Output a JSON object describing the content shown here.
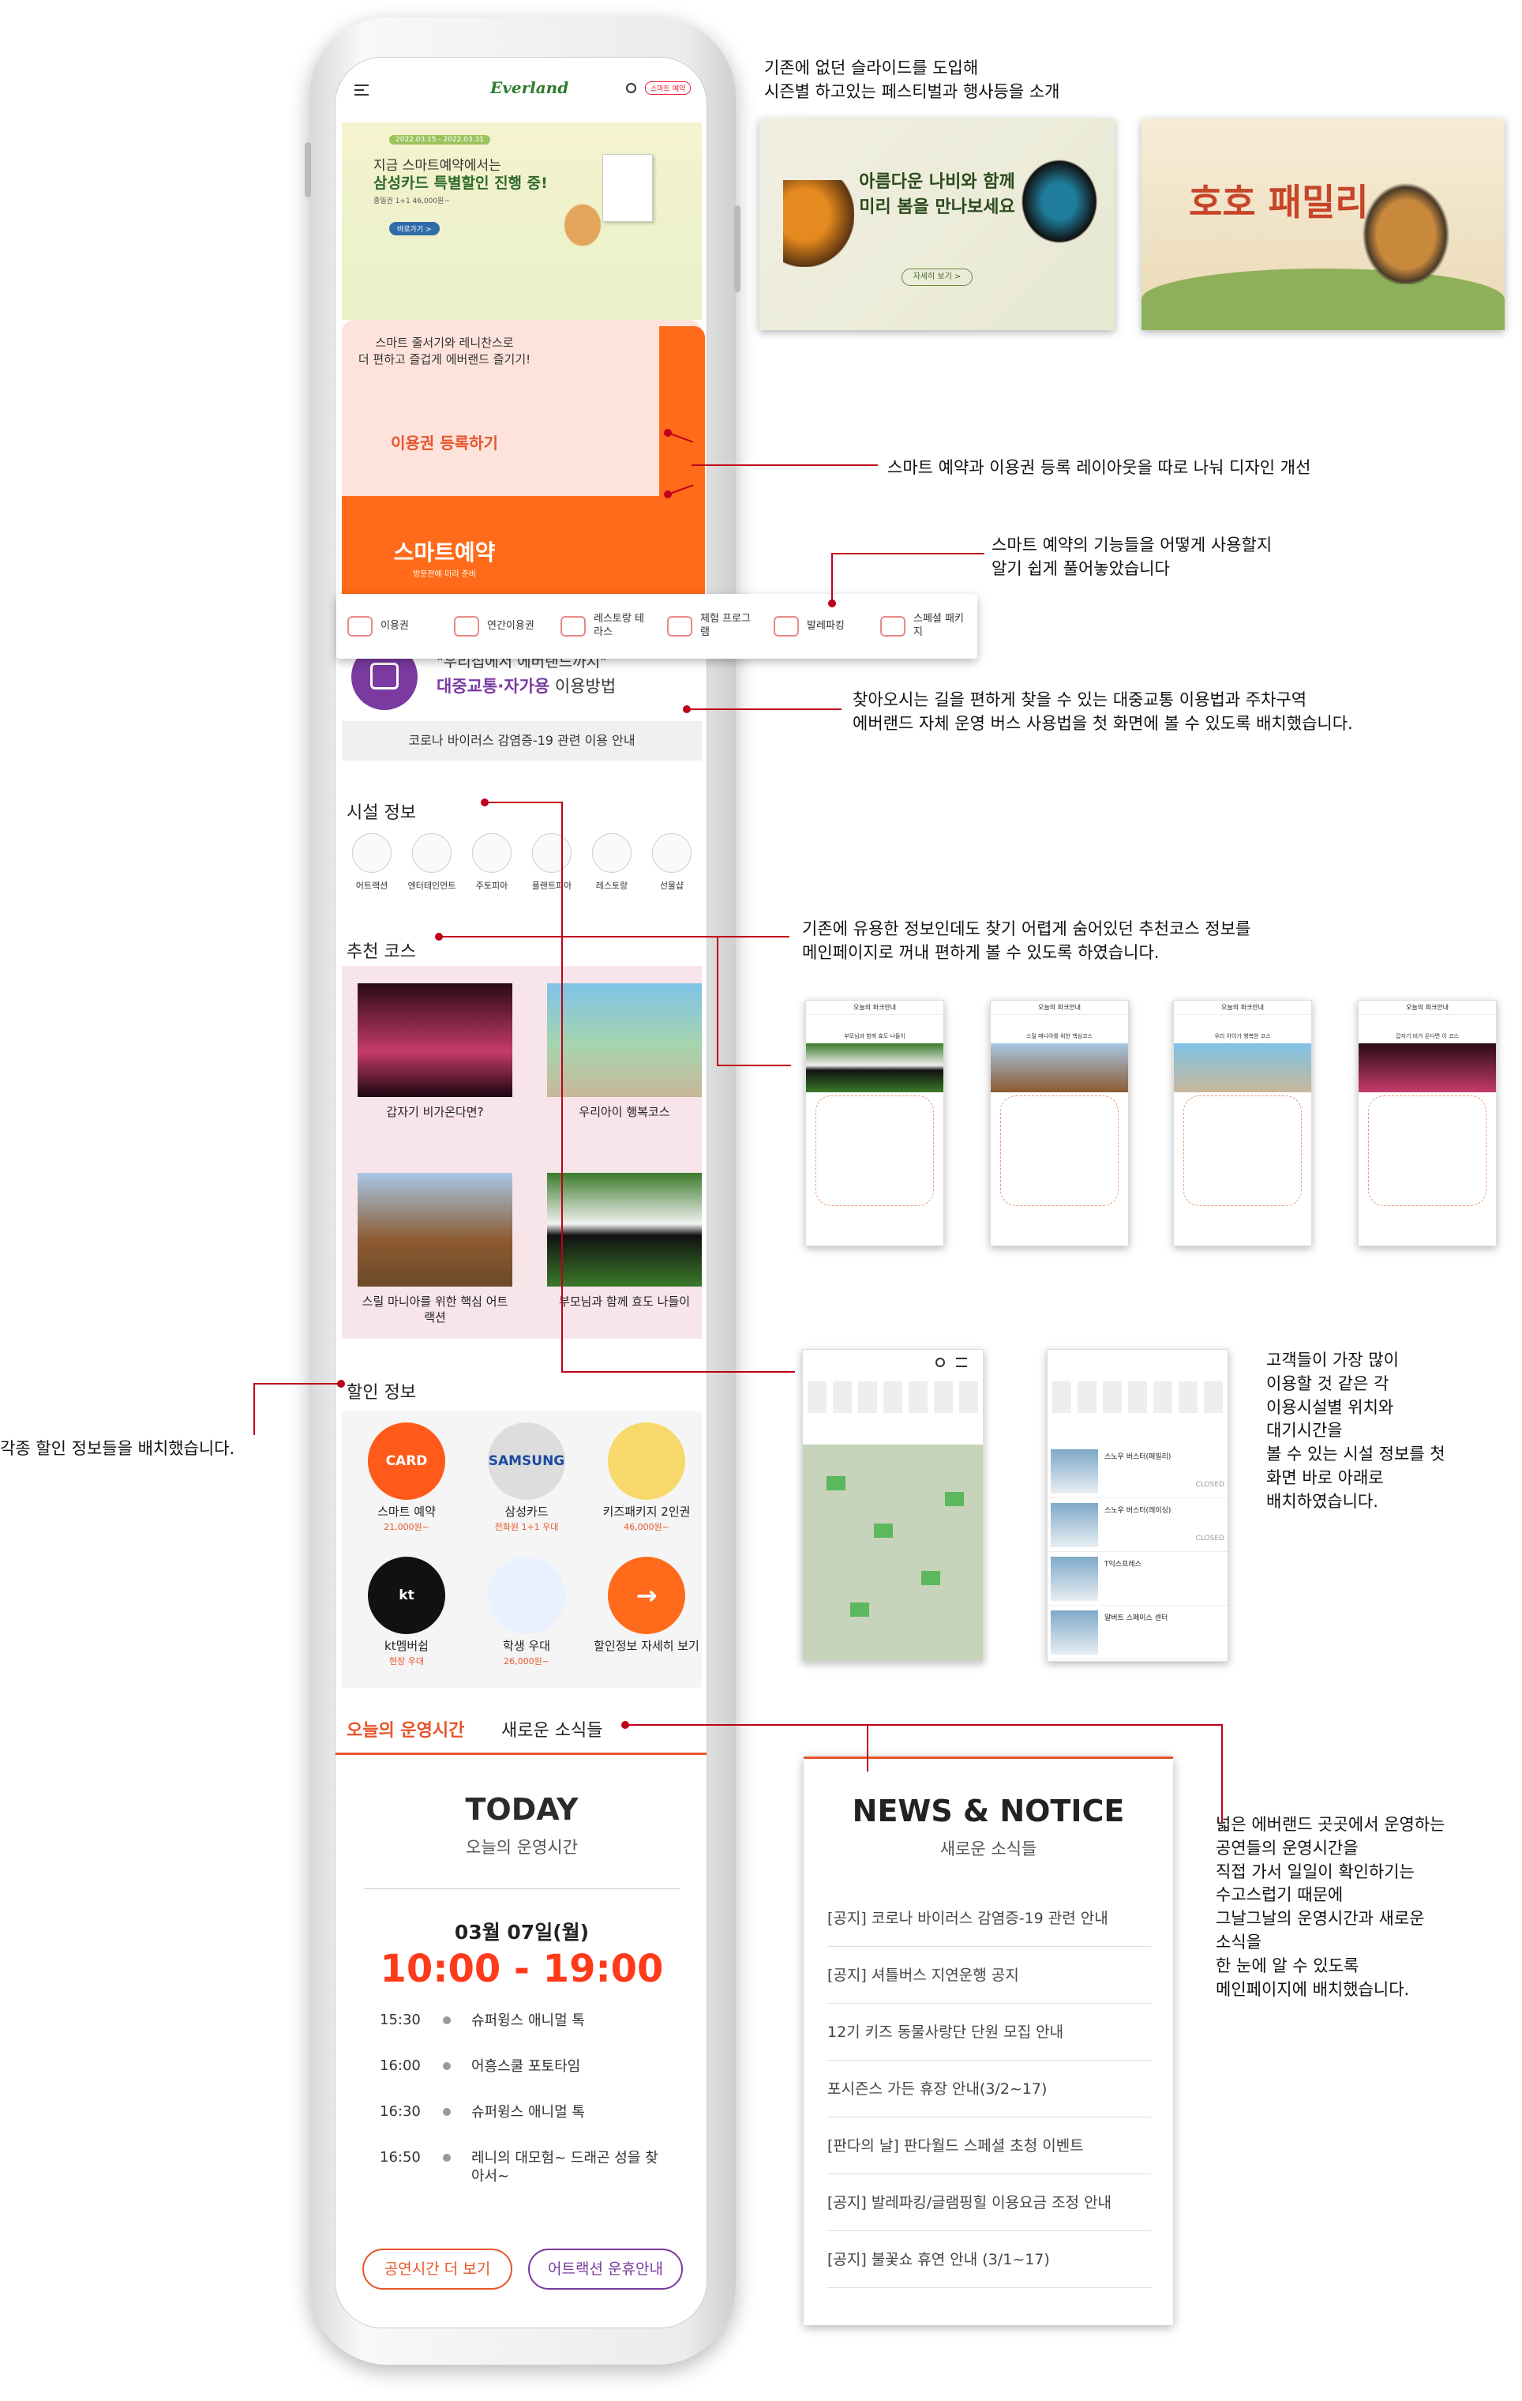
{
  "annotations": {
    "slides": [
      "기존에 없던 슬라이드를 도입해",
      "시즌별 하고있는 페스티벌과 행사등을 소개"
    ],
    "layout": "스마트 예약과 이용권 등록 레이아웃을 따로 나눠 디자인 개선",
    "smart": [
      "스마트 예약의 기능들을 어떻게 사용할지",
      "알기 쉽게 풀어놓았습니다"
    ],
    "transport": [
      "찾아오시는 길을 편하게 찾을 수 있는 대중교통 이용법과 주차구역",
      "에버랜드 자체 운영 버스 사용법을 첫 화면에 볼 수 있도록 배치했습니다."
    ],
    "course": [
      "기존에 유용한 정보인데도 찾기 어렵게 숨어있던 추천코스 정보를",
      "메인페이지로 꺼내 편하게 볼 수 있도록 하였습니다."
    ],
    "facility": [
      "고객들이 가장 많이",
      "이용할 것 같은 각",
      "이용시설별 위치와",
      "대기시간을",
      "볼 수 있는 시설 정보를 첫",
      "화면 바로 아래로",
      "배치하였습니다."
    ],
    "discount": "각종 할인 정보들을 배치했습니다.",
    "news": [
      "넓은 에버랜드 곳곳에서 운영하는",
      "공연들의 운영시간을",
      "직접 가서 일일이 확인하기는",
      "수고스럽기 때문에",
      "그날그날의 운영시간과 새로운",
      "소식을",
      "한 눈에 알 수 있도록",
      "메인페이지에 배치했습니다."
    ]
  },
  "header": {
    "logo": "Everland",
    "reserve_btn": "스마트 예약"
  },
  "banner": {
    "date": "2022.03.15 - 2022.03.31",
    "line1": "지금 스마트예약에서는",
    "line2": "삼성카드 특별할인 진행 중!",
    "sub": "종일권 1+1 46,000원~",
    "btn": "바로가기 >"
  },
  "register": {
    "desc1": "스마트 줄서기와 레니찬스로",
    "desc2": "더 편하고 즐겁게 에버랜드 즐기기!",
    "title": "이용권 등록하기"
  },
  "smart_reserve": {
    "title": "스마트예약",
    "sub": "방문전에 미리 준비"
  },
  "quick_menu": [
    {
      "label": "이용권"
    },
    {
      "label": "연간이용권"
    },
    {
      "label": "레스토랑 테라스"
    },
    {
      "label": "체험 프로그램"
    },
    {
      "label": "발레파킹"
    },
    {
      "label": "스페셜 패키지"
    }
  ],
  "transport": {
    "quote": "\"우리집에서 에버랜드까지\"",
    "highlight": "대중교통·자가용",
    "rest": " 이용방법",
    "corona": "코로나 바이러스 감염증-19  관련 이용 안내"
  },
  "facility": {
    "title": "시설 정보",
    "items": [
      "어트랙션",
      "엔터테인먼트",
      "주토피아",
      "플랜트피아",
      "레스토랑",
      "선물샵"
    ]
  },
  "course": {
    "title": "추천 코스",
    "items": [
      "갑자기 비가온다면?",
      "우리아이 행복코스",
      "스릴 마니아를 위한 핵심 어트랙션",
      "부모님과 함께 효도 나들이"
    ]
  },
  "discount": {
    "title": "할인 정보",
    "items": [
      {
        "badge": "CARD",
        "name": "스마트 예약",
        "price": "21,000원~"
      },
      {
        "badge": "SAMSUNG",
        "name": "삼성카드",
        "price": "전화원 1+1 우대"
      },
      {
        "badge": "",
        "name": "키즈패키지 2인권",
        "price": "46,000원~"
      },
      {
        "badge": "kt",
        "name": "kt멤버쉽",
        "price": "현장 우대"
      },
      {
        "badge": "",
        "name": "학생 우대",
        "price": "26,000원~"
      },
      {
        "badge": "→",
        "name": "할인정보 자세히 보기",
        "price": ""
      }
    ]
  },
  "tabs": {
    "active": "오늘의 운영시간",
    "other": "새로운 소식들"
  },
  "today": {
    "title": "TODAY",
    "sub": "오늘의 운영시간",
    "date": "03월 07일(월)",
    "hours": "10:00 - 19:00",
    "schedule": [
      {
        "time": "15:30",
        "event": "슈퍼윙스 애니멀 톡"
      },
      {
        "time": "16:00",
        "event": "어흥스쿨 포토타임"
      },
      {
        "time": "16:30",
        "event": "슈퍼윙스 애니멀 톡"
      },
      {
        "time": "16:50",
        "event": "레니의 대모험~ 드래곤 성을 찾아서~"
      }
    ],
    "btn1": "공연시간 더 보기",
    "btn2": "어트랙션 운휴안내"
  },
  "news": {
    "title": "NEWS & NOTICE",
    "sub": "새로운 소식들",
    "items": [
      "[공지] 코로나 바이러스 감염증-19 관련 안내",
      "[공지] 셔틀버스 지연운행 공지",
      "12기 키즈 동물사랑단 단원 모집 안내",
      "포시즌스 가든 휴장 안내(3/2~17)",
      "[판다의 날] 판다월드 스페셜 초청 이벤트",
      "[공지] 발레파킹/글램핑힐 이용요금 조정 안내",
      "[공지] 불꽃쇼 휴연 안내 (3/1~17)"
    ]
  },
  "slide_cards": {
    "card1": {
      "l1": "아름다운 나비와 함께",
      "l2": "미리 봄을 만나보세요",
      "btn": "자세히 보기 >"
    },
    "card2": {
      "title": "호호 패밀리"
    }
  },
  "course_screens": {
    "bar": "오늘의 파크안내",
    "titles": [
      "부모님과 함께 효도 나들이",
      "스릴 매니아를 위한 핵심코스",
      "우리 아이가 행복한 코스",
      "갑자기 비가 온다면 이 코스"
    ]
  },
  "map_screens": {
    "closed": "CLOSED",
    "items": [
      "스노우 버스터(패밀리)",
      "스노우 버스터(레이싱)",
      "T익스프레스",
      "알버트 스페이스 센터"
    ]
  },
  "colors": {
    "accent": "#f26a2a",
    "red": "#c0001a",
    "purple": "#7a3aa0",
    "orange": "#ff6b1a"
  }
}
